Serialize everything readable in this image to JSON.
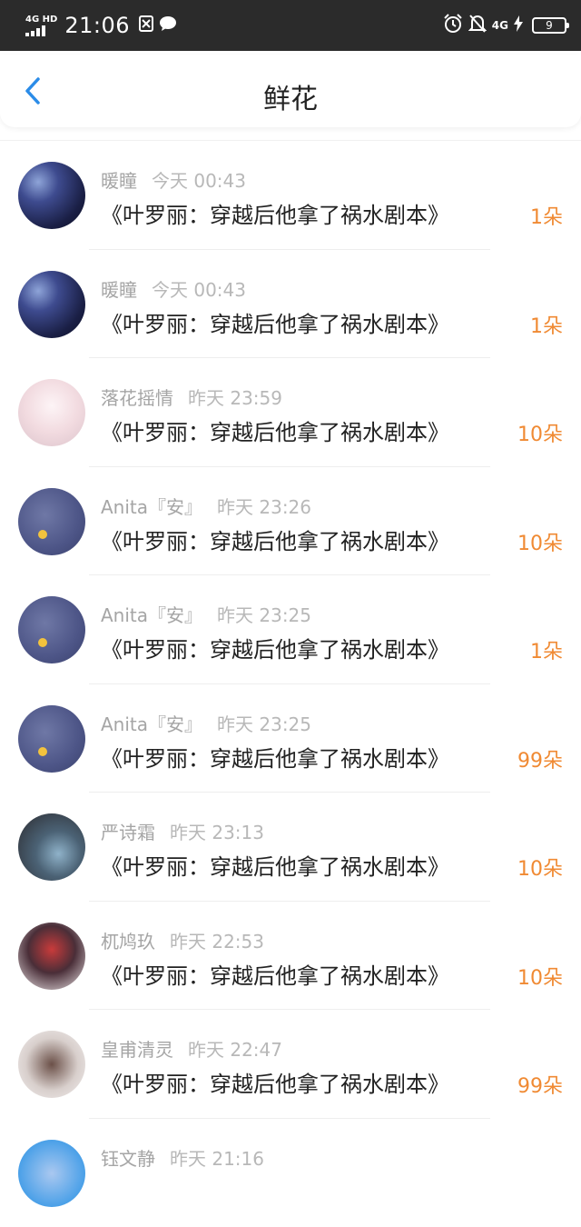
{
  "status_bar": {
    "network": "4G HD",
    "time": "21:06",
    "network_right": "4G",
    "battery": "9"
  },
  "header": {
    "title": "鲜花",
    "back_icon": "chevron-left-icon"
  },
  "items": [
    {
      "user": "暖瞳",
      "time": "今天 00:43",
      "book": "《叶罗丽：穿越后他拿了祸水剧本》",
      "amount": "1朵"
    },
    {
      "user": "暖瞳",
      "time": "今天 00:43",
      "book": "《叶罗丽：穿越后他拿了祸水剧本》",
      "amount": "1朵"
    },
    {
      "user": "落花摇情",
      "time": "昨天 23:59",
      "book": "《叶罗丽：穿越后他拿了祸水剧本》",
      "amount": "10朵"
    },
    {
      "user": "Anita『安』",
      "time": "昨天 23:26",
      "book": "《叶罗丽：穿越后他拿了祸水剧本》",
      "amount": "10朵"
    },
    {
      "user": "Anita『安』",
      "time": "昨天 23:25",
      "book": "《叶罗丽：穿越后他拿了祸水剧本》",
      "amount": "1朵"
    },
    {
      "user": "Anita『安』",
      "time": "昨天 23:25",
      "book": "《叶罗丽：穿越后他拿了祸水剧本》",
      "amount": "99朵"
    },
    {
      "user": "严诗霜",
      "time": "昨天 23:13",
      "book": "《叶罗丽：穿越后他拿了祸水剧本》",
      "amount": "10朵"
    },
    {
      "user": "杌鸠玖",
      "time": "昨天 22:53",
      "book": "《叶罗丽：穿越后他拿了祸水剧本》",
      "amount": "10朵"
    },
    {
      "user": "皇甫清灵",
      "time": "昨天 22:47",
      "book": "《叶罗丽：穿越后他拿了祸水剧本》",
      "amount": "99朵"
    },
    {
      "user": "钰文静",
      "time": "昨天 21:16",
      "book": "",
      "amount": ""
    }
  ],
  "colors": {
    "amount": "#f08a33",
    "accent": "#2b8ce8",
    "status_bar": "#2b2b2b"
  }
}
